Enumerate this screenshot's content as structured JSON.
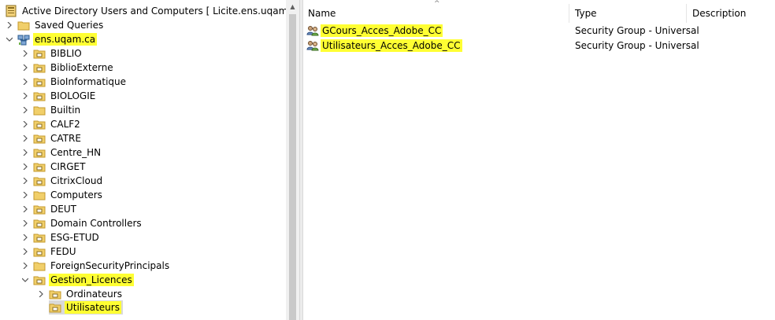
{
  "tree": {
    "root": {
      "label": "Active Directory Users and Computers [ Licite.ens.uqam.ca ]",
      "icon": "console-icon"
    },
    "saved_queries": {
      "label": "Saved Queries",
      "icon": "folder-icon"
    },
    "domain": {
      "label": "ens.uqam.ca",
      "icon": "domain-icon"
    },
    "ous": [
      {
        "label": "BIBLIO",
        "type": "ou"
      },
      {
        "label": "BiblioExterne",
        "type": "ou"
      },
      {
        "label": "BioInformatique",
        "type": "ou"
      },
      {
        "label": "BIOLOGIE",
        "type": "ou"
      },
      {
        "label": "Builtin",
        "type": "folder"
      },
      {
        "label": "CALF2",
        "type": "ou"
      },
      {
        "label": "CATRE",
        "type": "ou"
      },
      {
        "label": "Centre_HN",
        "type": "ou"
      },
      {
        "label": "CIRGET",
        "type": "ou"
      },
      {
        "label": "CitrixCloud",
        "type": "ou"
      },
      {
        "label": "Computers",
        "type": "folder"
      },
      {
        "label": "DEUT",
        "type": "ou"
      },
      {
        "label": "Domain Controllers",
        "type": "ou"
      },
      {
        "label": "ESG-ETUD",
        "type": "ou"
      },
      {
        "label": "FEDU",
        "type": "ou"
      },
      {
        "label": "ForeignSecurityPrincipals",
        "type": "folder"
      },
      {
        "label": "Gestion_Licences",
        "type": "ou"
      }
    ],
    "children": [
      {
        "label": "Ordinateurs"
      },
      {
        "label": "Utilisateurs"
      }
    ]
  },
  "list": {
    "columns": {
      "name": "Name",
      "type": "Type",
      "description": "Description"
    },
    "rows": [
      {
        "name": "GCours_Acces_Adobe_CC",
        "type": "Security Group - Universal",
        "description": ""
      },
      {
        "name": "Utilisateurs_Acces_Adobe_CC",
        "type": "Security Group - Universal",
        "description": ""
      }
    ]
  },
  "colors": {
    "highlight": "#ffff33",
    "selection": "#d9d9d9",
    "folder": "#e8c35a"
  }
}
